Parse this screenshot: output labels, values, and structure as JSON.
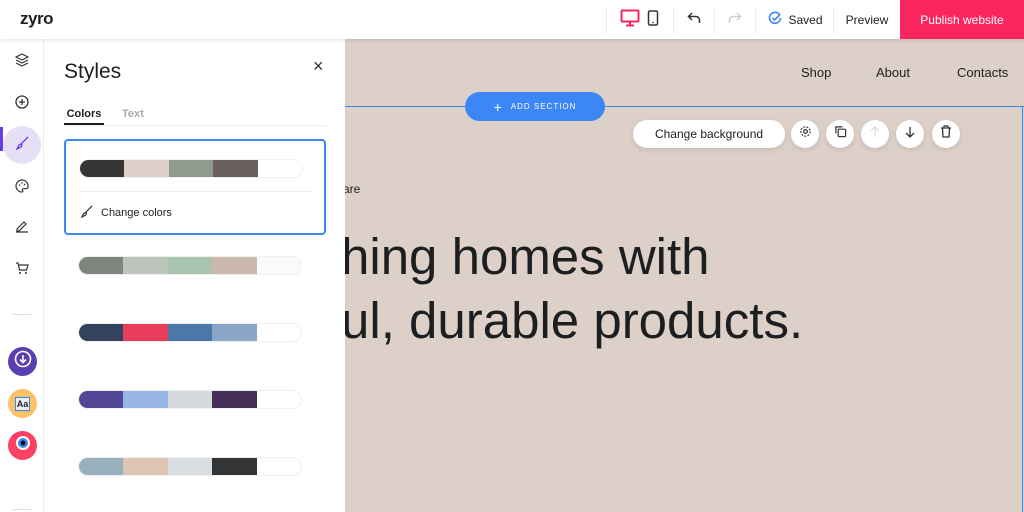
{
  "app": {
    "logo": "zyro"
  },
  "topbar": {
    "saved": "Saved",
    "preview": "Preview",
    "publish": "Publish website"
  },
  "panel": {
    "title": "Styles",
    "tabs": [
      "Colors",
      "Text"
    ],
    "change_colors": "Change colors",
    "palettes": [
      [
        "#363636",
        "#dcd0c8",
        "#8f9b8f",
        "#6c605f",
        "#ffffff"
      ],
      [
        "#7f857e",
        "#bdc4bb",
        "#a8c4ae",
        "#cbb8ae",
        "#fafafa"
      ],
      [
        "#33435d",
        "#e83e5c",
        "#4a78a8",
        "#89a6c9",
        "#ffffff"
      ],
      [
        "#534898",
        "#98b6e3",
        "#d4d9de",
        "#432f57",
        "#ffffff"
      ],
      [
        "#98b0bd",
        "#dfc5b3",
        "#d8dde2",
        "#333436",
        "#ffffff"
      ]
    ]
  },
  "canvas": {
    "nav": [
      "Shop",
      "About",
      "Contacts"
    ],
    "add_section": "ADD SECTION",
    "change_background": "Change background",
    "subtitle": "are",
    "headline_1": "hing homes with",
    "headline_2": "ul, durable products.",
    "background": "#dcd0c8"
  },
  "colors": {
    "accent": "#fc2560",
    "brand": "#673de6",
    "blue": "#3d86f5"
  }
}
